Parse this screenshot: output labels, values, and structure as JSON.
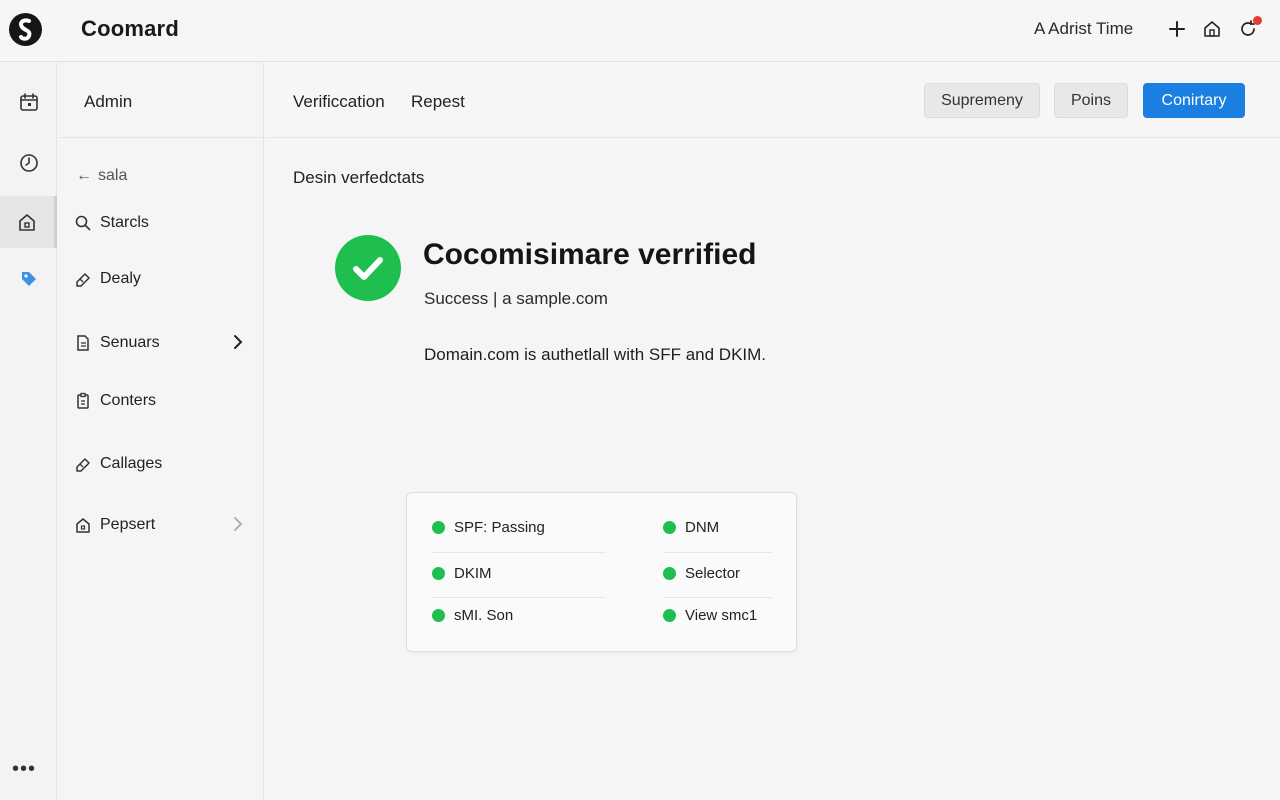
{
  "colors": {
    "accent": "#1a7fe0",
    "success": "#1fbf4f",
    "notification": "#e53935"
  },
  "header": {
    "app_title": "Coomard",
    "right_text": "A Adrist Time",
    "icons": [
      "plus-icon",
      "home-icon",
      "refresh-icon"
    ]
  },
  "rail": {
    "icons": [
      "calendar-icon",
      "clock-icon",
      "home-icon",
      "tag-icon"
    ],
    "more_label": "•••"
  },
  "sidebar": {
    "heading": "Admin",
    "back_label": "sala",
    "items": [
      {
        "label": "Starcls",
        "icon": "search-icon"
      },
      {
        "label": "Dealy",
        "icon": "tag-icon"
      },
      {
        "label": "Senuars",
        "icon": "document-icon",
        "has_chevron": true
      },
      {
        "label": "Conters",
        "icon": "clipboard-icon"
      },
      {
        "label": "Callages",
        "icon": "tag-icon"
      },
      {
        "label": "Pepsert",
        "icon": "home-icon",
        "has_chevron": true
      }
    ]
  },
  "content_header": {
    "breadcrumbs": [
      "Verificcation",
      "Repest"
    ],
    "buttons": {
      "secondary_1": "Supremeny",
      "secondary_2": "Poins",
      "primary": "Conirtary"
    }
  },
  "main": {
    "section_title": "Desin verfedctats",
    "verify_title": "Cocomisimare verrified",
    "verify_subtitle": "Success | a sample.com",
    "verify_description": "Domain.com is authetlall with SFF and DKIM."
  },
  "status_card": {
    "left": [
      "SPF: Passing",
      "DKIM",
      "sMI. Son"
    ],
    "right": [
      "DNM",
      "Selector",
      "View smc1"
    ]
  }
}
